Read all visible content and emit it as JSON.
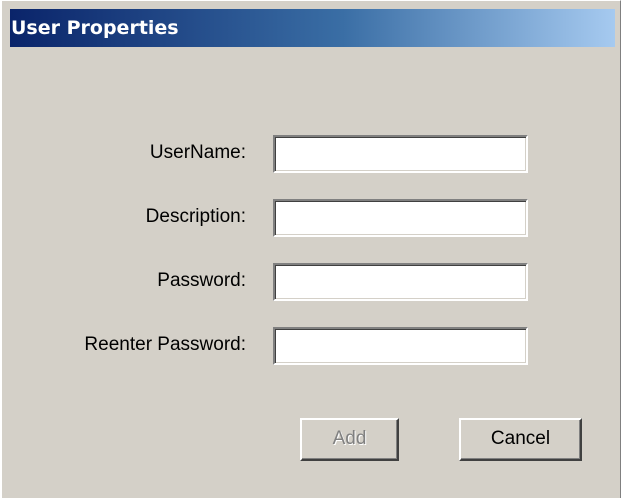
{
  "dialog": {
    "title": "User Properties"
  },
  "form": {
    "username": {
      "label": "UserName:",
      "value": "",
      "placeholder": ""
    },
    "description": {
      "label": "Description:",
      "value": "",
      "placeholder": ""
    },
    "password": {
      "label": "Password:",
      "value": "",
      "placeholder": ""
    },
    "reenter_password": {
      "label": "Reenter Password:",
      "value": "",
      "placeholder": ""
    }
  },
  "buttons": {
    "add": {
      "label": "Add",
      "enabled": false
    },
    "cancel": {
      "label": "Cancel",
      "enabled": true
    }
  },
  "colors": {
    "title_gradient_start": "#0a246a",
    "title_gradient_end": "#a6caf0",
    "dialog_background": "#d4d0c8",
    "disabled_text": "#808080"
  }
}
